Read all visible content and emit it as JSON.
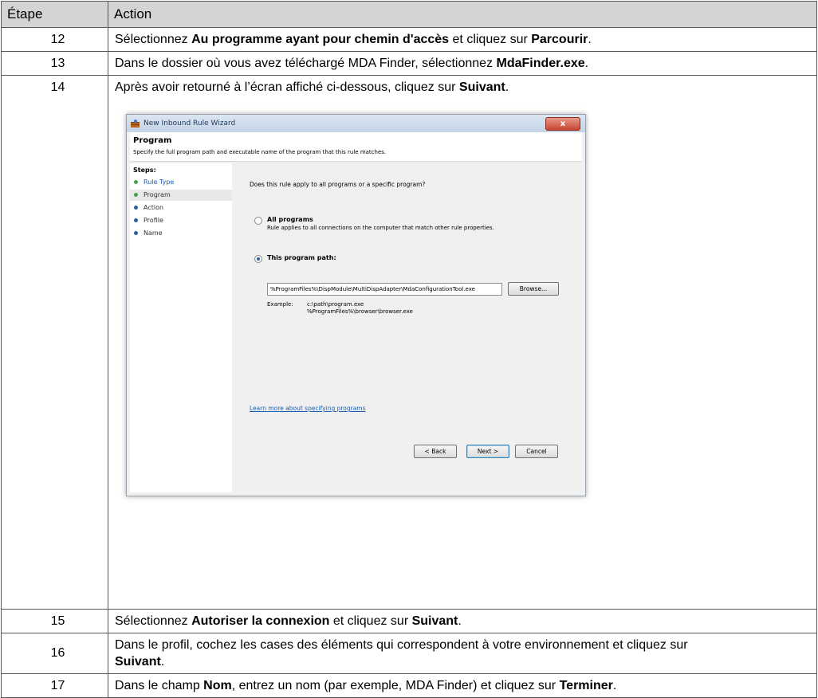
{
  "table": {
    "header": {
      "step": "Étape",
      "action": "Action"
    },
    "rows": [
      {
        "step": "12",
        "parts": [
          "Sélectionnez ",
          "Au programme ayant pour chemin d'accès",
          " et cliquez sur ",
          "Parcourir",
          "."
        ]
      },
      {
        "step": "13",
        "parts": [
          "Dans le dossier où vous avez téléchargé MDA Finder, sélectionnez ",
          "MdaFinder.exe",
          "."
        ]
      },
      {
        "step": "14",
        "parts": [
          "Après avoir retourné à l’écran affiché ci-dessous, cliquez sur ",
          "Suivant",
          "."
        ]
      },
      {
        "step": "15",
        "parts": [
          "Sélectionnez ",
          "Autoriser la connexion",
          " et cliquez sur ",
          "Suivant",
          "."
        ]
      },
      {
        "step": "16",
        "parts": [
          "Dans le profil, cochez les cases des éléments qui correspondent à votre environnement et cliquez sur ",
          "Suivant",
          "."
        ]
      },
      {
        "step": "17",
        "parts": [
          "Dans le champ ",
          "Nom",
          ", entrez un nom (par exemple, MDA Finder) et cliquez sur ",
          "Terminer",
          "."
        ]
      }
    ]
  },
  "wizard": {
    "title": "New Inbound Rule Wizard",
    "close_label": "x",
    "heading": "Program",
    "subheading": "Specify the full program path and executable name of the program that this rule matches.",
    "steps_label": "Steps:",
    "steps": [
      "Rule Type",
      "Program",
      "Action",
      "Profile",
      "Name"
    ],
    "question": "Does this rule apply to all programs or a specific program?",
    "all_programs_label": "All programs",
    "all_programs_desc": "Rule applies to all connections on the computer that match other rule properties.",
    "this_program_label": "This program path:",
    "program_path_value": "%ProgramFiles%\\DispModule\\MultiDispAdapter\\MdaConfigurationTool.exe",
    "browse_label": "Browse...",
    "example_label": "Example:",
    "example_1": "c:\\path\\program.exe",
    "example_2": "%ProgramFiles%\\browser\\browser.exe",
    "learn_more": "Learn more about specifying programs",
    "back_label": "< Back",
    "next_label": "Next >",
    "cancel_label": "Cancel",
    "colors": {
      "done_dot": "#3fa34d",
      "pending_dot": "#2c5ea8",
      "link": "#1a5fb4"
    }
  }
}
